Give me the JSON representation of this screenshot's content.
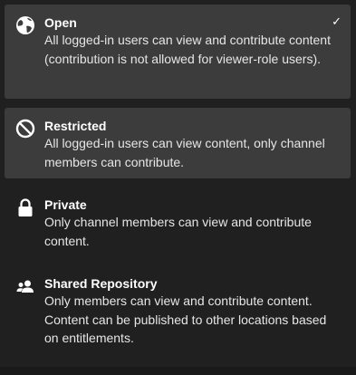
{
  "options": [
    {
      "icon": "globe-icon",
      "title": "Open",
      "description": "All logged-in users can view and contribute content (contribution is not allowed for viewer-role users).",
      "selected": true,
      "check": "✓"
    },
    {
      "icon": "restricted-icon",
      "title": "Restricted",
      "description": "All logged-in users can view content, only channel members can contribute."
    },
    {
      "icon": "lock-icon",
      "title": "Private",
      "description": "Only channel members can view and contribute content."
    },
    {
      "icon": "shared-users-icon",
      "title": "Shared Repository",
      "description": "Only members can view and contribute content. Content can be published to other locations based on entitlements."
    }
  ]
}
